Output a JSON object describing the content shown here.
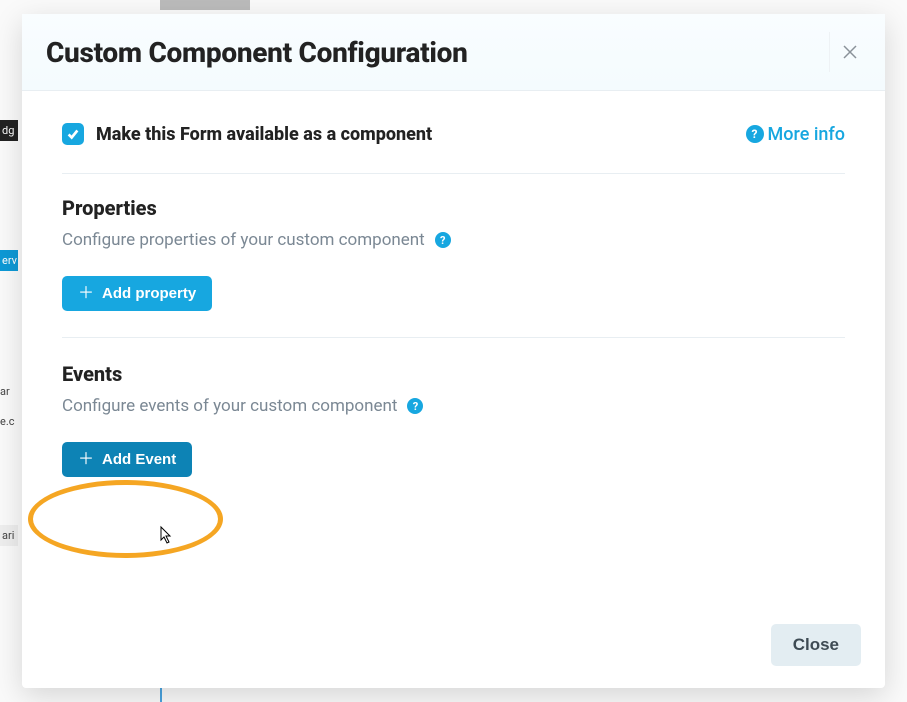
{
  "modal": {
    "title": "Custom Component Configuration",
    "makeAvailable": {
      "checked": true,
      "label": "Make this Form available as a component"
    },
    "moreInfo": "More info",
    "properties": {
      "title": "Properties",
      "description": "Configure properties of your custom component",
      "addButton": "Add property"
    },
    "events": {
      "title": "Events",
      "description": "Configure events of your custom component",
      "addButton": "Add Event"
    },
    "closeButton": "Close"
  },
  "colors": {
    "accent": "#17a7e0",
    "highlight": "#f5a623"
  }
}
